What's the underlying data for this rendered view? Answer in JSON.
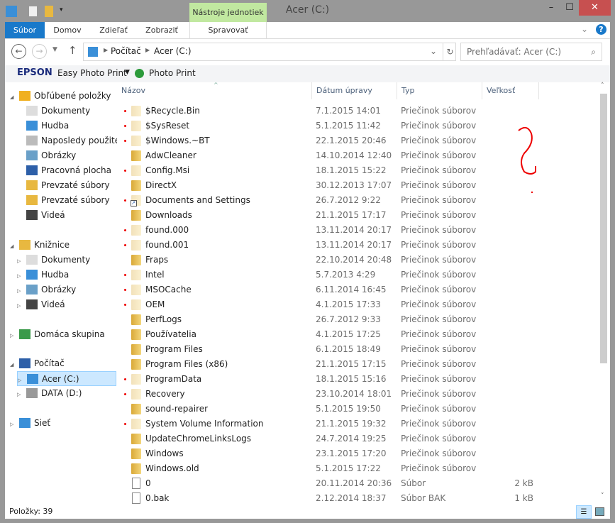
{
  "window": {
    "title": "Acer (C:)",
    "context_tab": "Nástroje jednotiek"
  },
  "ribbon": {
    "tabs": [
      "Súbor",
      "Domov",
      "Zdieľať",
      "Zobraziť",
      "Spravovať"
    ]
  },
  "address": {
    "crumbs": [
      "Počítač",
      "Acer (C:)"
    ],
    "search_placeholder": "Prehľadávať: Acer (C:)"
  },
  "epson": {
    "brand": "EPSON",
    "menu": "Easy Photo Print",
    "button": "Photo Print"
  },
  "nav": {
    "favorites": {
      "label": "Obľúbené položky",
      "items": [
        "Dokumenty",
        "Hudba",
        "Naposledy použité u",
        "Obrázky",
        "Pracovná plocha",
        "Prevzaté súbory",
        "Prevzaté súbory",
        "Videá"
      ]
    },
    "libraries": {
      "label": "Knižnice",
      "items": [
        "Dokumenty",
        "Hudba",
        "Obrázky",
        "Videá"
      ]
    },
    "homegroup": "Domáca skupina",
    "computer": {
      "label": "Počítač",
      "items": [
        "Acer (C:)",
        "DATA (D:)"
      ]
    },
    "network": "Sieť"
  },
  "columns": [
    "Názov",
    "Dátum úpravy",
    "Typ",
    "Veľkosť"
  ],
  "files": [
    {
      "name": "$Recycle.Bin",
      "date": "7.1.2015 14:01",
      "type": "Priečinok súborov",
      "size": "",
      "hidden": true
    },
    {
      "name": "$SysReset",
      "date": "5.1.2015 11:42",
      "type": "Priečinok súborov",
      "size": "",
      "hidden": true
    },
    {
      "name": "$Windows.~BT",
      "date": "22.1.2015 20:46",
      "type": "Priečinok súborov",
      "size": "",
      "hidden": true
    },
    {
      "name": "AdwCleaner",
      "date": "14.10.2014 12:40",
      "type": "Priečinok súborov",
      "size": "",
      "hidden": false
    },
    {
      "name": "Config.Msi",
      "date": "18.1.2015 15:22",
      "type": "Priečinok súborov",
      "size": "",
      "hidden": true
    },
    {
      "name": "DirectX",
      "date": "30.12.2013 17:07",
      "type": "Priečinok súborov",
      "size": "",
      "hidden": false
    },
    {
      "name": "Documents and Settings",
      "date": "26.7.2012 9:22",
      "type": "Priečinok súborov",
      "size": "",
      "hidden": true,
      "shortcut": true
    },
    {
      "name": "Downloads",
      "date": "21.1.2015 17:17",
      "type": "Priečinok súborov",
      "size": "",
      "hidden": false
    },
    {
      "name": "found.000",
      "date": "13.11.2014 20:17",
      "type": "Priečinok súborov",
      "size": "",
      "hidden": true
    },
    {
      "name": "found.001",
      "date": "13.11.2014 20:17",
      "type": "Priečinok súborov",
      "size": "",
      "hidden": true
    },
    {
      "name": "Fraps",
      "date": "22.10.2014 20:48",
      "type": "Priečinok súborov",
      "size": "",
      "hidden": false
    },
    {
      "name": "Intel",
      "date": "5.7.2013 4:29",
      "type": "Priečinok súborov",
      "size": "",
      "hidden": true
    },
    {
      "name": "MSOCache",
      "date": "6.11.2014 16:45",
      "type": "Priečinok súborov",
      "size": "",
      "hidden": true
    },
    {
      "name": "OEM",
      "date": "4.1.2015 17:33",
      "type": "Priečinok súborov",
      "size": "",
      "hidden": true
    },
    {
      "name": "PerfLogs",
      "date": "26.7.2012 9:33",
      "type": "Priečinok súborov",
      "size": "",
      "hidden": false
    },
    {
      "name": "Používatelia",
      "date": "4.1.2015 17:25",
      "type": "Priečinok súborov",
      "size": "",
      "hidden": false
    },
    {
      "name": "Program Files",
      "date": "6.1.2015 18:49",
      "type": "Priečinok súborov",
      "size": "",
      "hidden": false
    },
    {
      "name": "Program Files (x86)",
      "date": "21.1.2015 17:15",
      "type": "Priečinok súborov",
      "size": "",
      "hidden": false
    },
    {
      "name": "ProgramData",
      "date": "18.1.2015 15:16",
      "type": "Priečinok súborov",
      "size": "",
      "hidden": true
    },
    {
      "name": "Recovery",
      "date": "23.10.2014 18:01",
      "type": "Priečinok súborov",
      "size": "",
      "hidden": true
    },
    {
      "name": "sound-repairer",
      "date": "5.1.2015 19:50",
      "type": "Priečinok súborov",
      "size": "",
      "hidden": false
    },
    {
      "name": "System Volume Information",
      "date": "21.1.2015 19:32",
      "type": "Priečinok súborov",
      "size": "",
      "hidden": true
    },
    {
      "name": "UpdateChromeLinksLogs",
      "date": "24.7.2014 19:25",
      "type": "Priečinok súborov",
      "size": "",
      "hidden": false
    },
    {
      "name": "Windows",
      "date": "23.1.2015 17:20",
      "type": "Priečinok súborov",
      "size": "",
      "hidden": false
    },
    {
      "name": "Windows.old",
      "date": "5.1.2015 17:22",
      "type": "Priečinok súborov",
      "size": "",
      "hidden": false
    },
    {
      "name": "0",
      "date": "20.11.2014 20:36",
      "type": "Súbor",
      "size": "2 kB",
      "file": true
    },
    {
      "name": "0.bak",
      "date": "2.12.2014 18:37",
      "type": "Súbor BAK",
      "size": "1 kB",
      "file": true
    }
  ],
  "status": {
    "items": "Položky: 39"
  },
  "colors": {
    "accent": "#1979ca",
    "close": "#c75050",
    "context": "#c1e8a0",
    "annotation": "#e00000"
  }
}
